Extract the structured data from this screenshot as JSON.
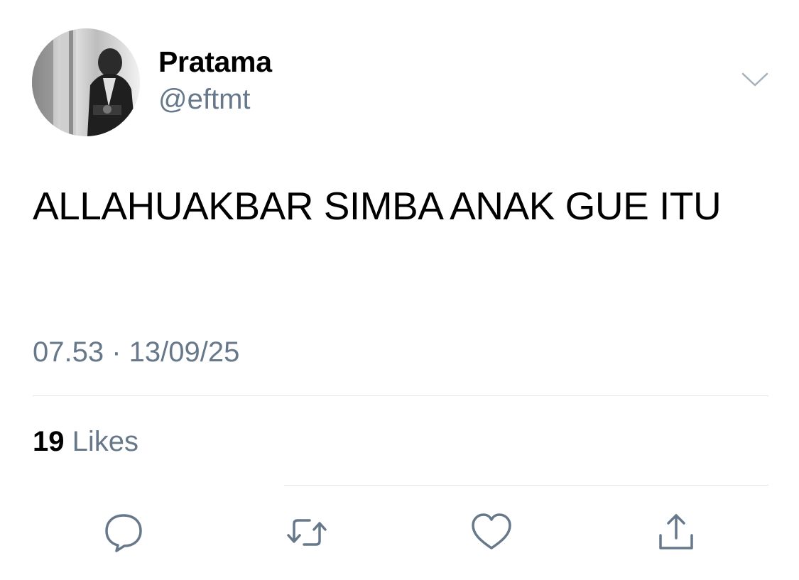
{
  "author": {
    "display_name": "Pratama",
    "handle": "@eftmt",
    "avatar_icon": "profile-photo"
  },
  "tweet": {
    "text": "ALLAHUAKBAR SIMBA ANAK GUE ITU",
    "timestamp": "07.53 · 13/09/25"
  },
  "stats": {
    "likes_count": "19",
    "likes_label": "Likes"
  },
  "actions": [
    {
      "name": "reply",
      "icon": "speech-bubble-icon"
    },
    {
      "name": "retweet",
      "icon": "retweet-arrows-icon"
    },
    {
      "name": "like",
      "icon": "heart-icon"
    },
    {
      "name": "share",
      "icon": "upload-arrow-icon"
    }
  ],
  "colors": {
    "text_primary": "#000000",
    "text_secondary": "#66788a",
    "divider": "#e1e6ea",
    "icon": "#66788a"
  }
}
